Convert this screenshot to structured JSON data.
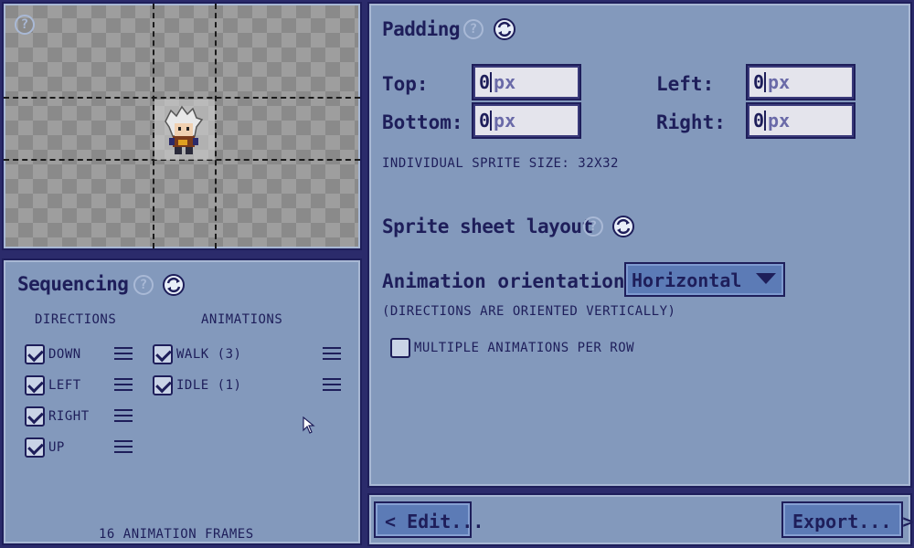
{
  "preview": {
    "help_icon": "question-icon"
  },
  "sequencing": {
    "title": "Sequencing",
    "directions_header": "DIRECTIONS",
    "animations_header": "ANIMATIONS",
    "directions": [
      {
        "label": "DOWN",
        "checked": true
      },
      {
        "label": "LEFT",
        "checked": true
      },
      {
        "label": "RIGHT",
        "checked": true
      },
      {
        "label": "UP",
        "checked": true
      }
    ],
    "animations": [
      {
        "label": "WALK (3)",
        "checked": true
      },
      {
        "label": "IDLE (1)",
        "checked": true
      }
    ],
    "frame_count": "16 ANIMATION FRAMES"
  },
  "padding": {
    "title": "Padding",
    "top_label": "Top:",
    "top_value": "0",
    "bottom_label": "Bottom:",
    "bottom_value": "0",
    "left_label": "Left:",
    "left_value": "0",
    "right_label": "Right:",
    "right_value": "0",
    "unit": "px",
    "sprite_size": "INDIVIDUAL SPRITE SIZE: 32X32"
  },
  "layout": {
    "title": "Sprite sheet layout",
    "orientation_label": "Animation orientation:",
    "orientation_value": "Horizontal",
    "orientation_note": "(DIRECTIONS ARE ORIENTED VERTICALLY)",
    "multi_row_label": "MULTIPLE ANIMATIONS PER ROW",
    "multi_row_checked": false
  },
  "footer": {
    "edit_label": "< Edit...",
    "export_label": "Export... >"
  },
  "colors": {
    "panel": "#8399bc",
    "border": "#1e1e5a",
    "button": "#5c7bb6",
    "background": "#2b2b6b"
  }
}
